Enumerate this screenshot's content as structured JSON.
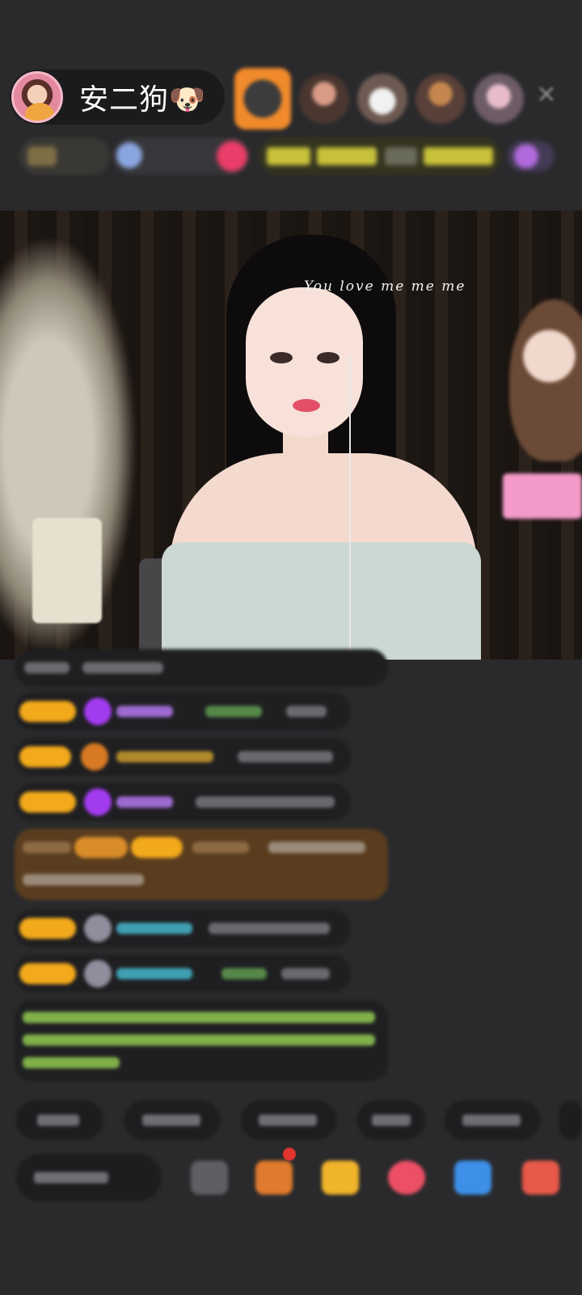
{
  "header": {
    "host_name": "安二狗🐶",
    "close_icon": "✕"
  },
  "video": {
    "overlay_text": "You love me me me"
  },
  "colors": {
    "background": "#2a2a2c",
    "pill": "#1b1b1d",
    "badge": "#f2a91b",
    "highlight_message": "#5a3d1e",
    "accent_pink": "#ea3d69"
  },
  "icons": {
    "host_avatar": "avatar",
    "close": "close-icon",
    "chat_input": "chat-input",
    "bottom_bar": [
      "emoji-icon",
      "gift-box-icon",
      "fan-club-icon",
      "heart-icon",
      "game-icon",
      "more-icon"
    ]
  }
}
